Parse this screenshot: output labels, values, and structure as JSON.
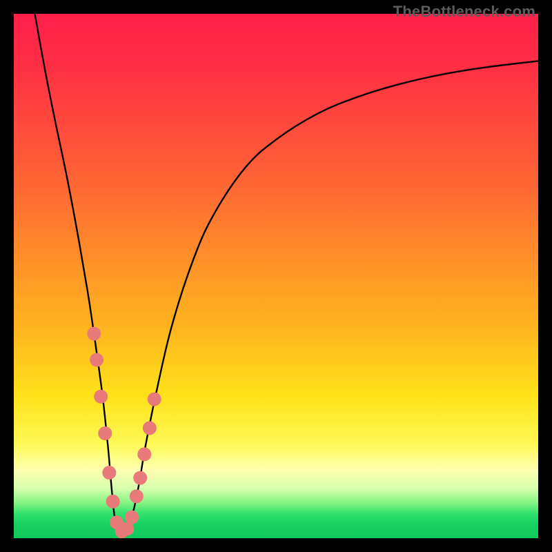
{
  "watermark": "TheBottleneck.com",
  "chart_data": {
    "type": "line",
    "title": "",
    "xlabel": "",
    "ylabel": "",
    "xlim": [
      0,
      100
    ],
    "ylim": [
      0,
      100
    ],
    "grid": false,
    "legend": false,
    "annotations": [],
    "gradient_stops": [
      {
        "offset": 0.0,
        "color": "#ff1f4b"
      },
      {
        "offset": 0.1,
        "color": "#ff2f44"
      },
      {
        "offset": 0.28,
        "color": "#ff5a38"
      },
      {
        "offset": 0.45,
        "color": "#ff8a2a"
      },
      {
        "offset": 0.6,
        "color": "#ffb51f"
      },
      {
        "offset": 0.73,
        "color": "#ffe21a"
      },
      {
        "offset": 0.82,
        "color": "#fef955"
      },
      {
        "offset": 0.87,
        "color": "#feffb0"
      },
      {
        "offset": 0.905,
        "color": "#d6ffae"
      },
      {
        "offset": 0.93,
        "color": "#8cf586"
      },
      {
        "offset": 0.955,
        "color": "#2ee06c"
      },
      {
        "offset": 0.975,
        "color": "#17d061"
      },
      {
        "offset": 1.0,
        "color": "#11c95c"
      }
    ],
    "series": [
      {
        "name": "bottleneck-curve",
        "x": [
          4,
          6,
          8,
          10,
          12,
          14,
          15,
          16,
          17,
          18,
          18.7,
          19.3,
          20,
          21,
          22,
          23,
          24,
          25,
          27,
          30,
          34,
          38,
          44,
          50,
          58,
          66,
          74,
          82,
          90,
          100
        ],
        "y": [
          100,
          89,
          79,
          69.5,
          59,
          47.5,
          41,
          34,
          26.5,
          17,
          9,
          3.5,
          1,
          1,
          2.5,
          6,
          11,
          17,
          27,
          40,
          52.5,
          61.5,
          70.5,
          76,
          81,
          84.3,
          86.7,
          88.5,
          89.8,
          91
        ]
      }
    ],
    "markers": {
      "name": "highlight-dots",
      "color": "#e97a7a",
      "radius": 10,
      "points_xy": [
        [
          15.3,
          39
        ],
        [
          15.8,
          34
        ],
        [
          16.6,
          27
        ],
        [
          17.4,
          20
        ],
        [
          18.2,
          12.5
        ],
        [
          18.9,
          7
        ],
        [
          19.6,
          3
        ],
        [
          20.6,
          1.3
        ],
        [
          21.6,
          1.8
        ],
        [
          22.5,
          4
        ],
        [
          23.4,
          8
        ],
        [
          24.1,
          11.5
        ],
        [
          24.9,
          16
        ],
        [
          25.9,
          21
        ],
        [
          26.8,
          26.5
        ]
      ]
    }
  }
}
